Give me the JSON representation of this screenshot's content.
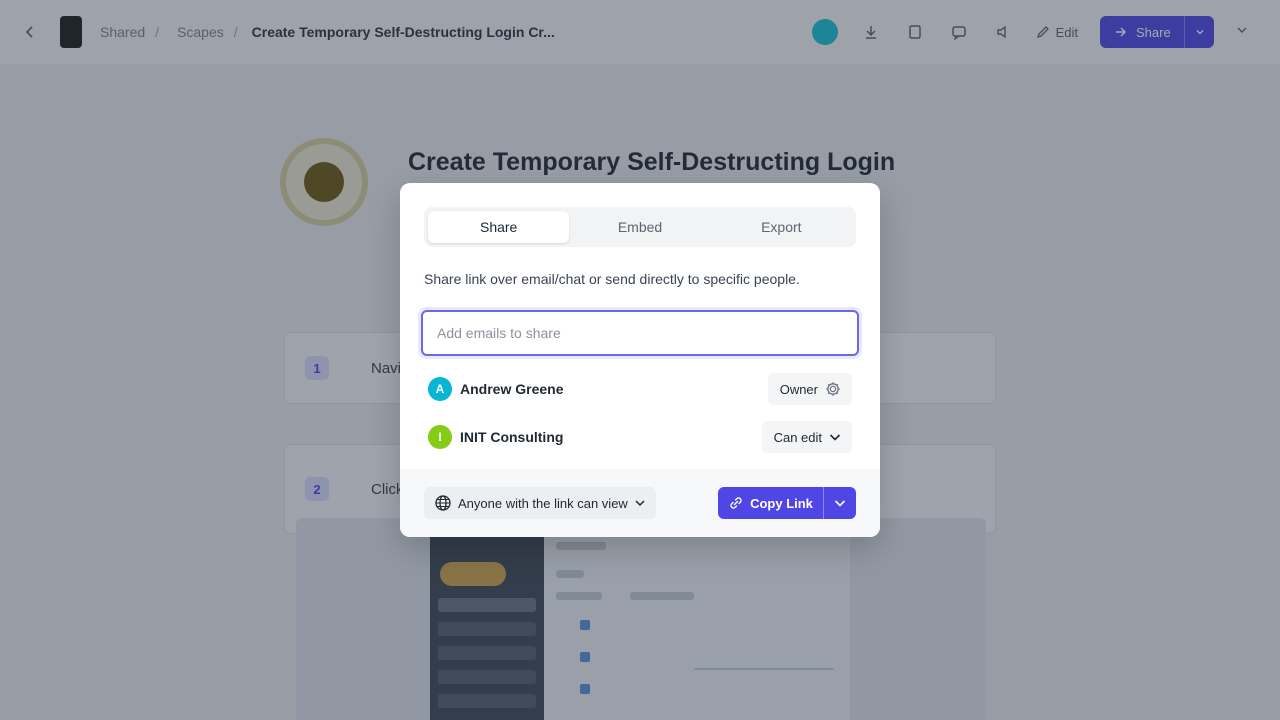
{
  "background": {
    "topbar": {
      "crumbs": [
        "Shared",
        "Scapes"
      ],
      "crumb_separator": "/",
      "doc_title": "Create Temporary Self-Destructing Login Cr...",
      "edit_label": "Edit",
      "share_label": "Share"
    },
    "document": {
      "title": "Create Temporary Self-Destructing Login",
      "steps": [
        {
          "number": "1",
          "label": "Navig"
        },
        {
          "number": "2",
          "label": "Click T"
        }
      ]
    }
  },
  "modal": {
    "tabs": [
      {
        "label": "Share",
        "active": true
      },
      {
        "label": "Embed",
        "active": false
      },
      {
        "label": "Export",
        "active": false
      }
    ],
    "description": "Share link over email/chat or send directly to specific people.",
    "email_input": {
      "value": "",
      "placeholder": "Add emails to share"
    },
    "people": [
      {
        "initial": "A",
        "name": "Andrew Greene",
        "role": "Owner",
        "role_icon": "gear-icon",
        "avatar_color": "#06b6d4"
      },
      {
        "initial": "I",
        "name": "INIT Consulting",
        "role": "Can edit",
        "role_icon": "chevron-down-icon",
        "avatar_color": "#84cc16"
      }
    ],
    "footer": {
      "access_label": "Anyone with the link can view",
      "copy_label": "Copy Link"
    }
  },
  "colors": {
    "accent": "#4f46e5",
    "input_focus": "#6d68e8"
  }
}
